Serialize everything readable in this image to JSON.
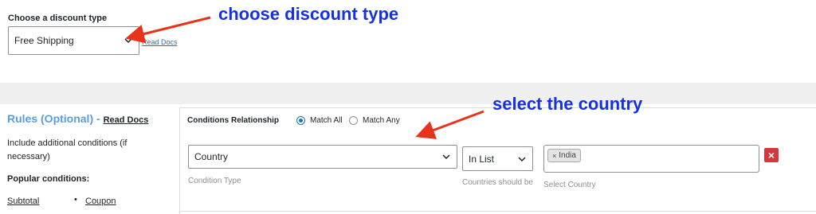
{
  "discount_type": {
    "label": "Choose a discount type",
    "selected": "Free Shipping",
    "read_docs": "Read Docs"
  },
  "annotations": {
    "top": "choose discount type",
    "middle": "select the country",
    "arrow_color": "#e8321c",
    "text_color": "#1531e6"
  },
  "rules": {
    "title": "Rules (Optional) -",
    "read_docs": "Read Docs",
    "description": "Include additional conditions (if necessary)",
    "popular_label": "Popular conditions:",
    "popular_items": [
      "Subtotal",
      "Coupon"
    ]
  },
  "conditions": {
    "relationship_label": "Conditions Relationship",
    "match_all": "Match All",
    "match_any": "Match Any",
    "selected_relationship": "Match All",
    "condition_type_value": "Country",
    "condition_type_hint": "Condition Type",
    "operator_value": "In List",
    "operator_hint": "Countries should be",
    "country_tag": "India",
    "country_hint": "Select Country",
    "remove_icon": "close-icon",
    "remove_color": "#d63638"
  }
}
